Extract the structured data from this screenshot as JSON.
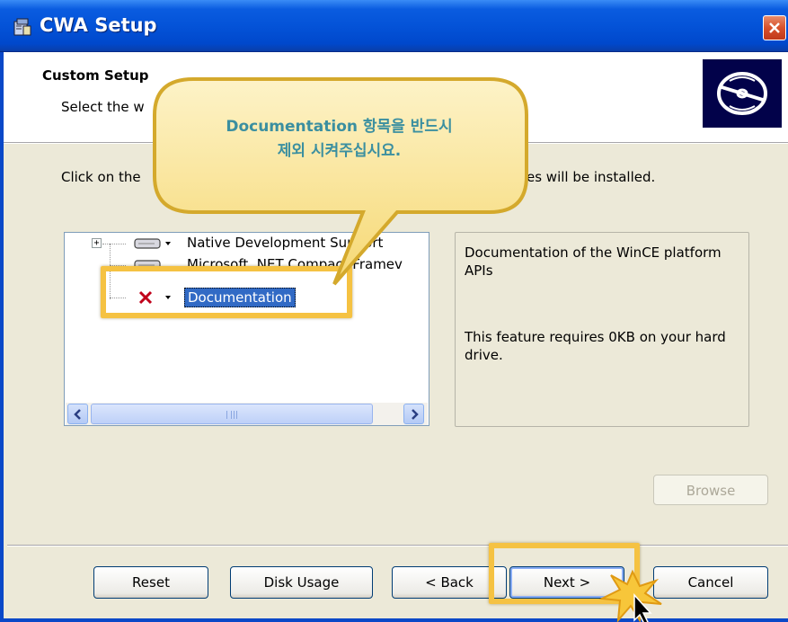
{
  "window": {
    "title": "CWA Setup",
    "close_label": "close"
  },
  "header": {
    "title": "Custom Setup",
    "subtitle": "Select the w"
  },
  "body": {
    "instruction_left": "Click on the",
    "instruction_right": "es will be installed."
  },
  "tree": {
    "items": [
      {
        "label": "Native Development Support",
        "icon": "drive-icon",
        "expandable": true
      },
      {
        "label": "Microsoft .NET Compact Framev",
        "icon": "drive-icon",
        "expandable": false
      },
      {
        "label": "Documentation",
        "icon": "excluded-x-icon",
        "expandable": false,
        "selected": true
      }
    ],
    "scroll_grip": "III"
  },
  "description": {
    "text": "Documentation of the WinCE platform APIs",
    "requirement": "This feature requires 0KB on your hard drive."
  },
  "buttons": {
    "browse": "Browse",
    "reset": "Reset",
    "disk_usage": "Disk Usage",
    "back": "< Back",
    "next": "Next >",
    "cancel": "Cancel"
  },
  "callout": {
    "line1": "Documentation 항목을 반드시",
    "line2": "제외 시켜주십시요."
  },
  "colors": {
    "titlebar": "#0453d8",
    "dialog_bg": "#ece9d8",
    "highlight": "#f5c242",
    "callout_fill": "#fbe9a0",
    "callout_text": "#3b8fa0",
    "selection": "#316ac5"
  }
}
